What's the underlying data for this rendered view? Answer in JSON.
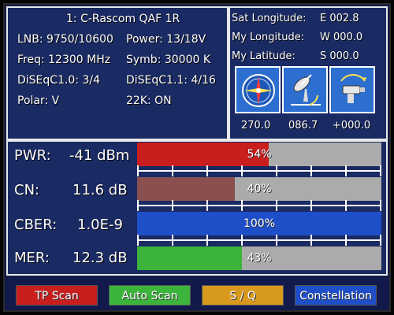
{
  "colors": {
    "pwr": "#c81e1e",
    "cn": "#8c4f4f",
    "cber": "#1e4fc8",
    "mer": "#3cb43c",
    "tp_scan": "#c81e1e",
    "auto_scan": "#3cb43c",
    "sq": "#d89a1e",
    "constellation": "#1e4fc8"
  },
  "satellite": {
    "title": "1: C-Rascom QAF 1R",
    "lnb": "LNB: 9750/10600",
    "power": "Power: 13/18V",
    "freq": "Freq: 12300 MHz",
    "symb": "Symb: 30000 K",
    "diseqc10": "DiSEqC1.0: 3/4",
    "diseqc11": "DiSEqC1.1: 4/16",
    "polar": "Polar: V",
    "k22": "22K: ON"
  },
  "position": {
    "sat_longitude_label": "Sat Longitude:",
    "sat_longitude_value": "E 002.8",
    "my_longitude_label": "My Longitude:",
    "my_longitude_value": "W 000.0",
    "my_latitude_label": "My Latitude:",
    "my_latitude_value": "S 000.0",
    "icons": [
      {
        "icon": "compass-icon",
        "value": "270.0"
      },
      {
        "icon": "dish-elevation-icon",
        "value": "086.7"
      },
      {
        "icon": "lnb-skew-icon",
        "value": "+000.0"
      }
    ]
  },
  "meters": [
    {
      "label": "PWR:",
      "value": "-41 dBm",
      "percent_text": "54%",
      "fraction": 0.54
    },
    {
      "label": "CN:",
      "value": "11.6 dB",
      "percent_text": "40%",
      "fraction": 0.4
    },
    {
      "label": "CBER:",
      "value": "1.0E-9",
      "percent_text": "100%",
      "fraction": 1.0
    },
    {
      "label": "MER:",
      "value": "12.3 dB",
      "percent_text": "43%",
      "fraction": 0.43
    }
  ],
  "buttons": {
    "tp_scan": "TP Scan",
    "auto_scan": "Auto Scan",
    "sq": "S / Q",
    "constellation": "Constellation"
  }
}
